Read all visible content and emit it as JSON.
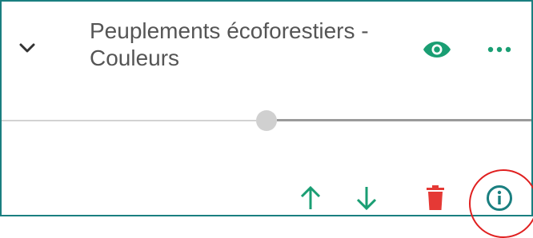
{
  "layer": {
    "title_line1": "Peuplements écoforestiers -",
    "title_line2": "Couleurs",
    "opacity": 0.5
  },
  "icons": {
    "collapse": "chevron-down-icon",
    "visibility": "eye-icon",
    "more": "more-horizontal-icon",
    "move_up": "arrow-up-icon",
    "move_down": "arrow-down-icon",
    "delete": "trash-icon",
    "info": "info-icon"
  },
  "colors": {
    "accent": "#1a9e73",
    "border": "#1a7f80",
    "delete": "#e53935",
    "info": "#1a7f80",
    "highlight": "#e02020",
    "title_text": "#555555"
  }
}
